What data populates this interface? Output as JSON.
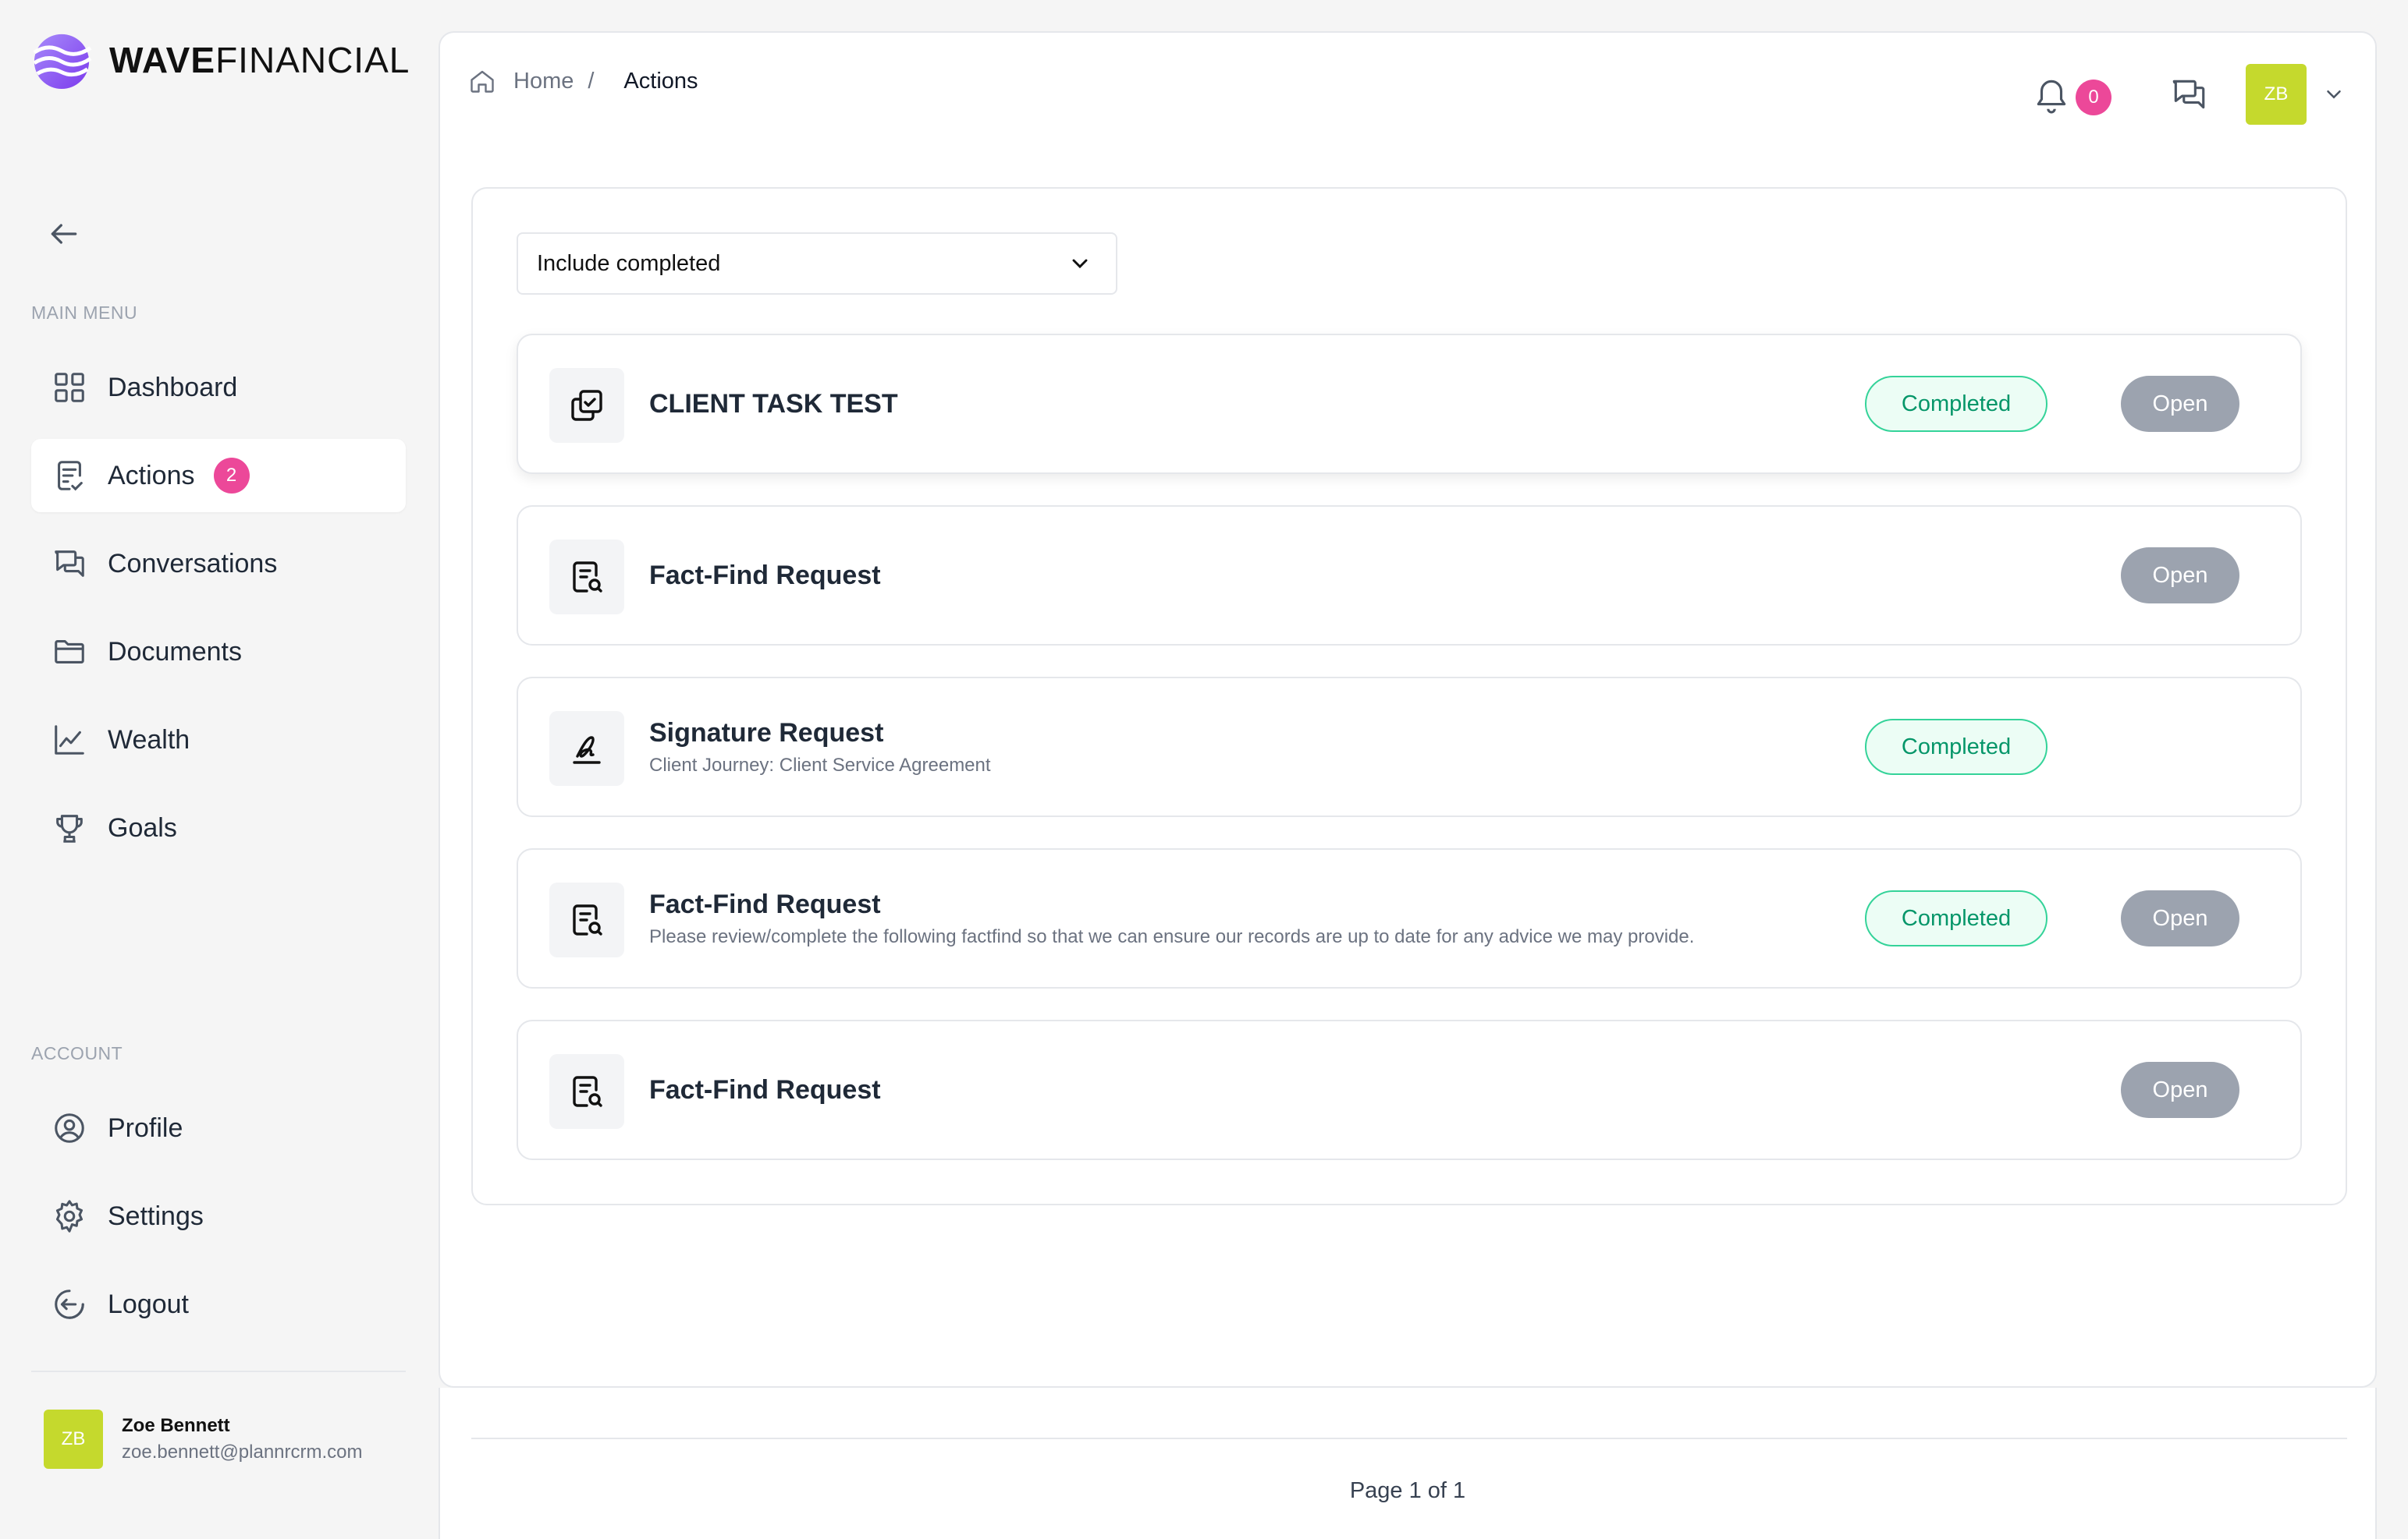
{
  "brand": {
    "name_bold": "WAVE",
    "name_rest": "FINANCIAL"
  },
  "sidebar": {
    "main_menu_label": "MAIN MENU",
    "account_label": "ACCOUNT",
    "main_items": [
      {
        "label": "Dashboard",
        "icon": "dashboard-icon"
      },
      {
        "label": "Actions",
        "icon": "actions-icon",
        "badge": "2",
        "active": true
      },
      {
        "label": "Conversations",
        "icon": "conversations-icon"
      },
      {
        "label": "Documents",
        "icon": "folder-icon"
      },
      {
        "label": "Wealth",
        "icon": "chart-line-icon"
      },
      {
        "label": "Goals",
        "icon": "trophy-icon"
      }
    ],
    "account_items": [
      {
        "label": "Profile",
        "icon": "user-circle-icon"
      },
      {
        "label": "Settings",
        "icon": "gear-icon"
      },
      {
        "label": "Logout",
        "icon": "logout-icon"
      }
    ],
    "user": {
      "initials": "ZB",
      "name": "Zoe Bennett",
      "email": "zoe.bennett@plannrcrm.com"
    }
  },
  "header": {
    "breadcrumb_home": "Home",
    "breadcrumb_sep": "/",
    "breadcrumb_current": "Actions",
    "notification_count": "0",
    "avatar_initials": "ZB"
  },
  "filter": {
    "selected": "Include completed"
  },
  "tasks": [
    {
      "title": "CLIENT TASK TEST",
      "subtitle": "",
      "status": "Completed",
      "open_label": "Open",
      "icon": "task-check-icon"
    },
    {
      "title": "Fact-Find Request",
      "subtitle": "",
      "status": "",
      "open_label": "Open",
      "icon": "document-search-icon"
    },
    {
      "title": "Signature Request",
      "subtitle": "Client Journey: Client Service Agreement",
      "status": "Completed",
      "open_label": "",
      "icon": "signature-icon"
    },
    {
      "title": "Fact-Find Request",
      "subtitle": "Please review/complete the following factfind so that we can ensure our records are up to date for any advice we may provide.",
      "status": "Completed",
      "open_label": "Open",
      "icon": "document-search-icon"
    },
    {
      "title": "Fact-Find Request",
      "subtitle": "",
      "status": "",
      "open_label": "Open",
      "icon": "document-search-icon"
    }
  ],
  "pagination": {
    "text": "Page 1 of 1"
  },
  "colors": {
    "accent_pink": "#ec4899",
    "avatar_lime": "#c5d92d",
    "status_green": "#059669",
    "button_gray": "#9ca3af"
  }
}
